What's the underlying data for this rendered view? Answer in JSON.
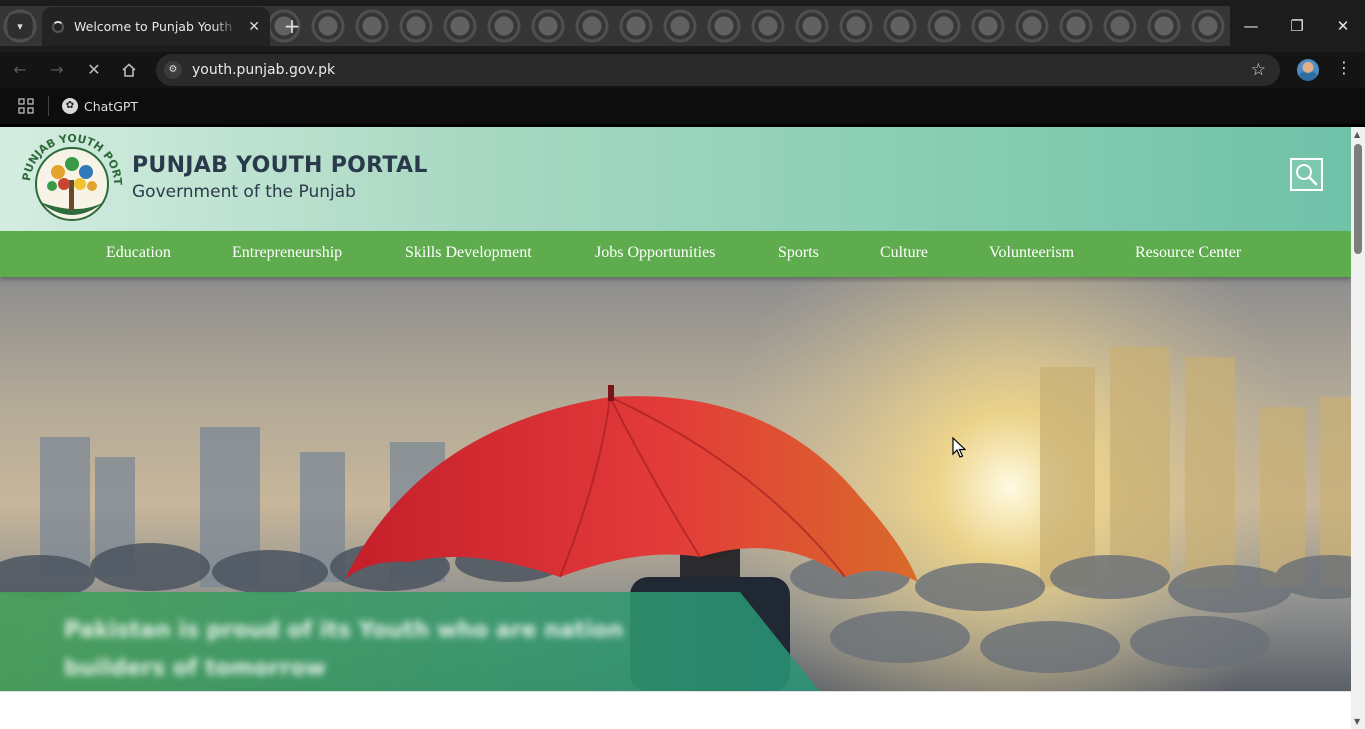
{
  "browser": {
    "tab": {
      "title": "Welcome to Punjab Youth Portal",
      "close_icon": "close-icon"
    },
    "new_tab_icon": "plus-icon",
    "window_controls": {
      "minimize": "—",
      "restore": "❐",
      "close": "✕"
    },
    "toolbar": {
      "back_icon": "arrow-left-icon",
      "forward_icon": "arrow-right-icon",
      "stop_icon": "close-icon",
      "home_icon": "home-icon",
      "url": "youth.punjab.gov.pk",
      "bookmark_icon": "star-icon"
    },
    "bookmarks": [
      {
        "label": "ChatGPT",
        "icon": "openai-icon"
      }
    ]
  },
  "site": {
    "logo_text": "PUNJAB YOUTH PORTAL",
    "title": "PUNJAB YOUTH PORTAL",
    "subtitle": "Government of the Punjab",
    "search_icon": "search-icon",
    "nav": [
      "Education",
      "Entrepreneurship",
      "Skills Development",
      "Jobs Opportunities",
      "Sports",
      "Culture",
      "Volunteerism",
      "Resource Center"
    ],
    "hero": {
      "caption": "Pakistan is proud of its Youth who are nation builders of tomorrow"
    }
  },
  "colors": {
    "nav_green": "#5fac4e",
    "header_gradient_start": "#d4ede0",
    "header_gradient_end": "#6fc2a8",
    "umbrella_red": "#d8262d"
  }
}
